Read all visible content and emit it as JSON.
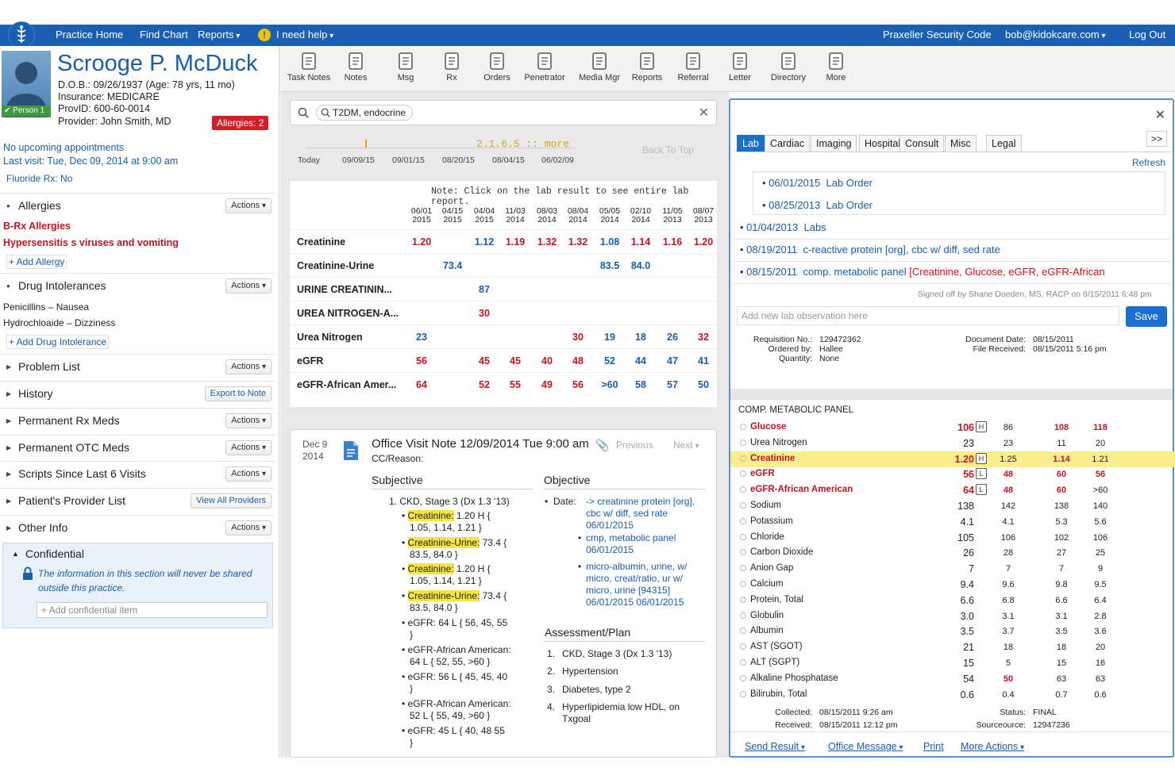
{
  "topbar": {
    "practice_home": "Practice Home",
    "find_chart": "Find Chart",
    "reports": "Reports",
    "help": "I need help",
    "security_code": "Praxeller Security Code",
    "user": "bob@kidokcare.com",
    "logout": "Log Out"
  },
  "patient": {
    "name": "Scrooge P. McDuck",
    "dob": "D.O.B.: 09/26/1937 (Age: 78 yrs, 11 mo)",
    "insurance": "Insurance: MEDICARE",
    "provid": "ProvID: 600-60-0014",
    "provider": "Provider: John Smith, MD",
    "person_badge": "Person 1",
    "allergies_badge": "Allergies: 2",
    "upcoming": "No upcoming appointments",
    "last_visit": "Last visit: Tue, Dec 09, 2014 at 9:00 am",
    "fluoride": "Fluoride Rx: No"
  },
  "sections": {
    "allergies": {
      "title": "Allergies",
      "action": "Actions",
      "items": [
        "B-Rx Allergies",
        "Hypersensitis s viruses and vomiting"
      ],
      "add": "+ Add Allergy"
    },
    "drug_intolerances": {
      "title": "Drug Intolerances",
      "action": "Actions",
      "items": [
        "Penicillins  –  Nausea",
        "Hydrochloaide  –  Dizziness"
      ],
      "add": "+ Add Drug Intolerance"
    },
    "problem_list": {
      "title": "Problem List",
      "action": "Actions"
    },
    "history": {
      "title": "History",
      "action": "Export to Note"
    },
    "permanent_rx": {
      "title": "Permanent Rx Meds",
      "action": "Actions"
    },
    "permanent_otc": {
      "title": "Permanent OTC Meds",
      "action": "Actions"
    },
    "scripts": {
      "title": "Scripts Since Last 6 Visits",
      "action": "Actions"
    },
    "provider_list": {
      "title": "Patient's Provider List",
      "action": "View All Providers"
    },
    "other_info": {
      "title": "Other Info",
      "action": "Actions"
    },
    "confidential": {
      "title": "Confidential",
      "text": "The information in this section will never be shared outside this practice.",
      "placeholder": "+ Add confidential item"
    }
  },
  "toolbar": [
    "Task Notes",
    "Notes",
    "Msg",
    "Rx",
    "Orders",
    "Penetrator",
    "Media Mgr",
    "Reports",
    "Referral",
    "Letter",
    "Directory",
    "More"
  ],
  "search": {
    "value": "T2DM, endocrine"
  },
  "timeline": {
    "dates": [
      "Today",
      "09/09/15",
      "09/01/15",
      "08/20/15",
      "08/04/15",
      "06/02/09"
    ],
    "marker": "2.1.6.5  ::  more",
    "back_to_top": "Back To Top"
  },
  "lab_trend": {
    "note": "Note: Click on the lab result to see entire lab report.",
    "columns": [
      [
        "06/01",
        "2015"
      ],
      [
        "04/15",
        "2015"
      ],
      [
        "04/04",
        "2015"
      ],
      [
        "11/03",
        "2014"
      ],
      [
        "08/03",
        "2014"
      ],
      [
        "08/04",
        "2014"
      ],
      [
        "05/05",
        "2014"
      ],
      [
        "02/10",
        "2014"
      ],
      [
        "11/05",
        "2013"
      ],
      [
        "08/07",
        "2013"
      ]
    ],
    "rows": [
      {
        "name": "Creatinine",
        "values": [
          [
            "1.20",
            "r"
          ],
          [
            "",
            ""
          ],
          [
            "1.12",
            "b"
          ],
          [
            "1.19",
            "r"
          ],
          [
            "1.32",
            "r"
          ],
          [
            "1.32",
            "r"
          ],
          [
            "1.08",
            "b"
          ],
          [
            "1.14",
            "r"
          ],
          [
            "1.16",
            "r"
          ],
          [
            "1.20",
            "r"
          ]
        ]
      },
      {
        "name": "Creatinine-Urine",
        "values": [
          [
            "",
            ""
          ],
          [
            "73.4",
            "b"
          ],
          [
            "",
            ""
          ],
          [
            "",
            ""
          ],
          [
            "",
            ""
          ],
          [
            "",
            ""
          ],
          [
            "83.5",
            "b"
          ],
          [
            "84.0",
            "b"
          ],
          [
            "",
            ""
          ],
          [
            "",
            ""
          ]
        ]
      },
      {
        "name": "URINE CREATININ...",
        "values": [
          [
            "",
            ""
          ],
          [
            "",
            ""
          ],
          [
            "87",
            "b"
          ],
          [
            "",
            ""
          ],
          [
            "",
            ""
          ],
          [
            "",
            ""
          ],
          [
            "",
            ""
          ],
          [
            "",
            ""
          ],
          [
            "",
            ""
          ],
          [
            "",
            ""
          ]
        ]
      },
      {
        "name": "UREA NITROGEN-A...",
        "values": [
          [
            "",
            ""
          ],
          [
            "",
            ""
          ],
          [
            "30",
            "r"
          ],
          [
            "",
            ""
          ],
          [
            "",
            ""
          ],
          [
            "",
            ""
          ],
          [
            "",
            ""
          ],
          [
            "",
            ""
          ],
          [
            "",
            ""
          ],
          [
            "",
            ""
          ]
        ]
      },
      {
        "name": "Urea Nitrogen",
        "values": [
          [
            "23",
            "b"
          ],
          [
            "",
            ""
          ],
          [
            "",
            ""
          ],
          [
            "",
            ""
          ],
          [
            "",
            ""
          ],
          [
            "30",
            "r"
          ],
          [
            "19",
            "b"
          ],
          [
            "18",
            "b"
          ],
          [
            "26",
            "b"
          ],
          [
            "32",
            "r"
          ]
        ]
      },
      {
        "name": "eGFR",
        "values": [
          [
            "56",
            "r"
          ],
          [
            "",
            ""
          ],
          [
            "45",
            "r"
          ],
          [
            "45",
            "r"
          ],
          [
            "40",
            "r"
          ],
          [
            "48",
            "r"
          ],
          [
            "52",
            "b"
          ],
          [
            "44",
            "b"
          ],
          [
            "47",
            "b"
          ],
          [
            "41",
            "b"
          ]
        ]
      },
      {
        "name": "eGFR-African Amer...",
        "values": [
          [
            "64",
            "r"
          ],
          [
            "",
            ""
          ],
          [
            "52",
            "r"
          ],
          [
            "55",
            "r"
          ],
          [
            "49",
            "r"
          ],
          [
            "56",
            "r"
          ],
          [
            ">60",
            "b"
          ],
          [
            "58",
            "b"
          ],
          [
            "57",
            "b"
          ],
          [
            "50",
            "b"
          ]
        ]
      }
    ]
  },
  "visit_note": {
    "date_day": "Dec 9",
    "date_year": "2014",
    "title": "Office Visit Note 12/09/2014 Tue 9:00 am",
    "previous": "Previous",
    "next": "Next",
    "cc": "CC/Reason:",
    "subjective": "Subjective",
    "objective": "Objective",
    "assessment": "Assessment/Plan",
    "subj_item": "1.   CKD, Stage 3 (Dx 1.3 '13)",
    "obj_date": "Date:",
    "obj_links": [
      "-> creatinine protein [org], cbc w/ diff, sed rate 06/01/2015",
      "cmp, metabolic panel 06/01/2015",
      "micro-albumin, urine, w/ micro, creat/ratio, ur w/ micro, urine [94315] 06/01/2015 06/01/2015"
    ],
    "plan": [
      "CKD, Stage 3 (Dx 1.3 '13)",
      "Hypertension",
      "Diabetes, type 2",
      "Hyperlipidemia low HDL, on Txgoal"
    ],
    "bullets": [
      {
        "hl": "Creatinine:",
        "rest": " 1.20 H {",
        "line2": "1.05, 1.14, 1.21 }"
      },
      {
        "hl": "Creatinine-Urine:",
        "rest": " 73.4 {",
        "line2": "83.5, 84.0 }"
      },
      {
        "hl": "Creatinine:",
        "rest": " 1.20 H {",
        "line2": "1.05, 1.14, 1.21 }"
      },
      {
        "hl": "Creatinine-Urine:",
        "rest": " 73.4 {",
        "line2": "83.5, 84.0 }"
      },
      {
        "hl": "",
        "rest": "eGFR: 64 L { 56, 45, 55",
        "line2": "}"
      },
      {
        "hl": "",
        "rest": "eGFR-African American:",
        "line2": "64 L { 52, 55, >60 }"
      },
      {
        "hl": "",
        "rest": "eGFR: 56 L { 45, 45, 40",
        "line2": "}"
      },
      {
        "hl": "",
        "rest": "eGFR-African American:",
        "line2": "52 L { 55, 49, >60 }"
      },
      {
        "hl": "",
        "rest": "eGFR: 45 L { 40, 48  55",
        "line2": "}"
      }
    ]
  },
  "right": {
    "tabs": [
      "Lab",
      "Cardiac",
      "Imaging",
      "Hospital",
      "Consult",
      "Misc",
      "Legal"
    ],
    "more": ">>",
    "refresh": "Refresh",
    "orders": [
      {
        "date": "06/01/2015",
        "desc": "Lab Order",
        "red": ""
      },
      {
        "date": "08/25/2013",
        "desc": "Lab Order",
        "red": ""
      },
      {
        "date": "01/04/2013",
        "desc": "Labs",
        "red": ""
      },
      {
        "date": "08/19/2011",
        "desc": "c-reactive protein [org], cbc w/ diff, sed rate",
        "red": ""
      },
      {
        "date": "08/15/2011",
        "desc": "comp. metabolic panel",
        "red": "[Creatinine, Glucose, eGFR, eGFR-African"
      }
    ],
    "signed": "Signed off by Shane Doeden, MS, RACP on 8/15/2011 6:48 pm",
    "obs_placeholder": "Add new lab observation here",
    "save": "Save",
    "req_labels": [
      "Requisition No.:",
      "Ordered by:",
      "Quantity:"
    ],
    "req_values": [
      "129472362",
      "Hallee",
      "None"
    ],
    "doc_labels": [
      "Document Date:",
      "File Received:"
    ],
    "doc_values": [
      "08/15/2011",
      "08/15/2011 5:16 pm"
    ],
    "panel_title": "COMP. METABOLIC PANEL",
    "metabolic": [
      {
        "name": "Glucose",
        "val": "106",
        "flag": "H",
        "c1": "86",
        "c2": "108",
        "c3": "118",
        "style": "red",
        "cs": [
          "",
          "r",
          "r"
        ]
      },
      {
        "name": "Urea Nitrogen",
        "val": "23",
        "flag": "",
        "c1": "23",
        "c2": "11",
        "c3": "20",
        "style": "",
        "cs": [
          "",
          "",
          ""
        ]
      },
      {
        "name": "Creatinine",
        "val": "1.20",
        "flag": "H",
        "c1": "1.25",
        "c2": "1.14",
        "c3": "1.21",
        "style": "red",
        "cs": [
          "",
          "r",
          ""
        ],
        "hl": true
      },
      {
        "name": "eGFR",
        "val": "56",
        "flag": "L",
        "c1": "48",
        "c2": "60",
        "c3": "56",
        "style": "red",
        "cs": [
          "r",
          "r",
          "r"
        ]
      },
      {
        "name": "eGFR-African American",
        "val": "64",
        "flag": "L",
        "c1": "48",
        "c2": "60",
        "c3": ">60",
        "style": "red",
        "cs": [
          "r",
          "r",
          ""
        ]
      },
      {
        "name": "Sodium",
        "val": "138",
        "flag": "",
        "c1": "142",
        "c2": "138",
        "c3": "140",
        "style": "",
        "cs": [
          "",
          "",
          ""
        ]
      },
      {
        "name": "Potassium",
        "val": "4.1",
        "flag": "",
        "c1": "4.1",
        "c2": "5.3",
        "c3": "5.6",
        "style": "",
        "cs": [
          "",
          "",
          ""
        ]
      },
      {
        "name": "Chloride",
        "val": "105",
        "flag": "",
        "c1": "106",
        "c2": "102",
        "c3": "106",
        "style": "",
        "cs": [
          "",
          "",
          ""
        ]
      },
      {
        "name": "Carbon Dioxide",
        "val": "26",
        "flag": "",
        "c1": "28",
        "c2": "27",
        "c3": "25",
        "style": "",
        "cs": [
          "",
          "",
          ""
        ]
      },
      {
        "name": "Anion Gap",
        "val": "7",
        "flag": "",
        "c1": "7",
        "c2": "7",
        "c3": "9",
        "style": "",
        "cs": [
          "",
          "",
          ""
        ]
      },
      {
        "name": "Calcium",
        "val": "9.4",
        "flag": "",
        "c1": "9.6",
        "c2": "9.8",
        "c3": "9.5",
        "style": "",
        "cs": [
          "",
          "",
          ""
        ]
      },
      {
        "name": "Protein, Total",
        "val": "6.6",
        "flag": "",
        "c1": "6.8",
        "c2": "6.6",
        "c3": "6.4",
        "style": "",
        "cs": [
          "",
          "",
          ""
        ]
      },
      {
        "name": "Globulin",
        "val": "3.0",
        "flag": "",
        "c1": "3.1",
        "c2": "3.1",
        "c3": "2.8",
        "style": "",
        "cs": [
          "",
          "",
          ""
        ]
      },
      {
        "name": "Albumin",
        "val": "3.5",
        "flag": "",
        "c1": "3.7",
        "c2": "3.5",
        "c3": "3.6",
        "style": "",
        "cs": [
          "",
          "",
          ""
        ]
      },
      {
        "name": "AST (SGOT)",
        "val": "21",
        "flag": "",
        "c1": "18",
        "c2": "18",
        "c3": "20",
        "style": "",
        "cs": [
          "",
          "",
          ""
        ]
      },
      {
        "name": "ALT (SGPT)",
        "val": "15",
        "flag": "",
        "c1": "5",
        "c2": "15",
        "c3": "16",
        "style": "",
        "cs": [
          "",
          "",
          ""
        ]
      },
      {
        "name": "Alkaline Phosphatase",
        "val": "54",
        "flag": "",
        "c1": "50",
        "c2": "63",
        "c3": "63",
        "style": "",
        "cs": [
          "r",
          "",
          ""
        ]
      },
      {
        "name": "Bilirubin, Total",
        "val": "0.6",
        "flag": "",
        "c1": "0.4",
        "c2": "0.7",
        "c3": "0.6",
        "style": "",
        "cs": [
          "",
          "",
          ""
        ]
      }
    ],
    "collected_label": "Collected:",
    "collected": "08/15/2011 9:26 am",
    "received_label": "Received:",
    "received": "08/15/2011 12:12 pm",
    "status_label": "Status:",
    "status": "FINAL",
    "source_label": "Sourceource:",
    "source": "12947236",
    "footer": [
      "Send Result",
      "Office Message",
      "Print",
      "More Actions"
    ]
  }
}
